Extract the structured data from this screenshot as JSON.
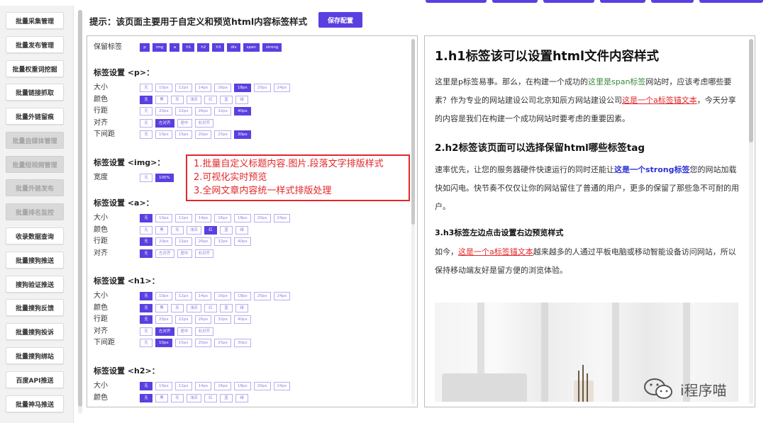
{
  "sidebar": {
    "items": [
      {
        "label": "批量采集管理",
        "disabled": false
      },
      {
        "label": "批量发布管理",
        "disabled": false
      },
      {
        "label": "批量权重词挖掘",
        "disabled": false
      },
      {
        "label": "批量链接抓取",
        "disabled": false
      },
      {
        "label": "批量外链留痕",
        "disabled": false
      },
      {
        "label": "批量自媒体管理",
        "disabled": true
      },
      {
        "label": "批量短视频管理",
        "disabled": true
      },
      {
        "label": "批量外链发布",
        "disabled": true
      },
      {
        "label": "批量排名监控",
        "disabled": true
      },
      {
        "label": "收录数据查询",
        "disabled": false
      },
      {
        "label": "批量搜狗推送",
        "disabled": false
      },
      {
        "label": "搜狗验证推送",
        "disabled": false
      },
      {
        "label": "批量搜狗反馈",
        "disabled": false
      },
      {
        "label": "批量搜狗投诉",
        "disabled": false
      },
      {
        "label": "批量搜狗绑站",
        "disabled": false
      },
      {
        "label": "百度API推送",
        "disabled": false
      },
      {
        "label": "批量神马推送",
        "disabled": false
      }
    ]
  },
  "header": {
    "hint": "提示：该页面主要用于自定义和预览html内容标签样式",
    "save_label": "保存配置"
  },
  "config": {
    "keep_label": "保留标签",
    "keep_tags": [
      "p",
      "img",
      "a",
      "h1",
      "h2",
      "h3",
      "div",
      "span",
      "strong"
    ],
    "sections": [
      {
        "title": "标签设置 <p>：",
        "rows": [
          {
            "label": "大小",
            "options": [
              "无",
              "10px",
              "12px",
              "14px",
              "16px",
              "18px",
              "20px",
              "24px"
            ],
            "selected": 5
          },
          {
            "label": "颜色",
            "options": [
              "无",
              "黑",
              "灰",
              "浅灰",
              "红",
              "蓝",
              "绿"
            ],
            "selected": 0
          },
          {
            "label": "行距",
            "options": [
              "无",
              "20px",
              "22px",
              "26px",
              "32px",
              "40px"
            ],
            "selected": 5
          },
          {
            "label": "对齐",
            "options": [
              "无",
              "左对齐",
              "居中",
              "右对齐"
            ],
            "selected": 1
          },
          {
            "label": "下间距",
            "options": [
              "无",
              "10px",
              "15px",
              "20px",
              "25px",
              "30px"
            ],
            "selected": 5
          }
        ]
      },
      {
        "title": "标签设置 <img>：",
        "rows": [
          {
            "label": "宽度",
            "options": [
              "无",
              "100%"
            ],
            "selected": 1
          }
        ]
      },
      {
        "title": "标签设置 <a>：",
        "rows": [
          {
            "label": "大小",
            "options": [
              "无",
              "10px",
              "12px",
              "14px",
              "16px",
              "18px",
              "20px",
              "24px"
            ],
            "selected": 0
          },
          {
            "label": "颜色",
            "options": [
              "无",
              "黑",
              "灰",
              "浅灰",
              "红",
              "蓝",
              "绿"
            ],
            "selected": 4
          },
          {
            "label": "行距",
            "options": [
              "无",
              "20px",
              "22px",
              "26px",
              "32px",
              "40px"
            ],
            "selected": 0
          },
          {
            "label": "对齐",
            "options": [
              "无",
              "左对齐",
              "居中",
              "右对齐"
            ],
            "selected": 0
          }
        ]
      },
      {
        "title": "标签设置 <h1>：",
        "rows": [
          {
            "label": "大小",
            "options": [
              "无",
              "10px",
              "12px",
              "14px",
              "16px",
              "18px",
              "20px",
              "24px"
            ],
            "selected": 0
          },
          {
            "label": "颜色",
            "options": [
              "无",
              "黑",
              "灰",
              "浅灰",
              "红",
              "蓝",
              "绿"
            ],
            "selected": 0
          },
          {
            "label": "行距",
            "options": [
              "无",
              "20px",
              "22px",
              "26px",
              "32px",
              "40px"
            ],
            "selected": 0
          },
          {
            "label": "对齐",
            "options": [
              "无",
              "左对齐",
              "居中",
              "右对齐"
            ],
            "selected": 1
          },
          {
            "label": "下间距",
            "options": [
              "无",
              "10px",
              "15px",
              "20px",
              "25px",
              "30px"
            ],
            "selected": 1
          }
        ]
      },
      {
        "title": "标签设置 <h2>：",
        "rows": [
          {
            "label": "大小",
            "options": [
              "无",
              "10px",
              "12px",
              "14px",
              "16px",
              "18px",
              "20px",
              "24px"
            ],
            "selected": 0
          },
          {
            "label": "颜色",
            "options": [
              "无",
              "黑",
              "灰",
              "浅灰",
              "红",
              "蓝",
              "绿"
            ],
            "selected": 0
          }
        ]
      }
    ]
  },
  "annotation": {
    "line1": "1.批量自定义标题内容.图片.段落文字排版样式",
    "line2": "2.可视化实时预览",
    "line3": "3.全网文章内容统一样式排版处理"
  },
  "preview": {
    "h1": "1.h1标签该可以设置html文件内容样式",
    "p1_a": "这里是p标签易事。那么，在构建一个成功的",
    "p1_span": "这里是span标签",
    "p1_b": "网站时，应该考虑哪些要素？作为专业的网站建设公司北京知辰方网站建设公司",
    "p1_link": "这是一个a标签锚文本",
    "p1_c": "，今天分享的内容是我们在构建一个成功网站时要考虑的重要因素。",
    "h2": "2.h2标签该页面可以选择保留html哪些标签tag",
    "p2_a": "速率优先，让您的服务器硬件快速运行的同时还能让",
    "p2_strong": "这是一个strong标签",
    "p2_b": "您的网站加载快如闪电。快节奏不仅仅让你的网站留住了普通的用户，更多的保留了那些急不可耐的用户。",
    "h3": "3.h3标签左边点击设置右边预览样式",
    "p3_a": "如今，",
    "p3_link": "这是一个a标签锚文本",
    "p3_b": "越来越多的人通过平板电脑或移动智能设备访问网站，所以保持移动端友好是留方便的浏览体验。"
  },
  "watermark": {
    "text": "i程序喵"
  },
  "colors": {
    "accent": "#5b3fe0",
    "annotation_red": "#e3272b",
    "link_red": "#e3272b",
    "span_green": "#3a8a3a",
    "strong_blue": "#2b2fd6"
  }
}
